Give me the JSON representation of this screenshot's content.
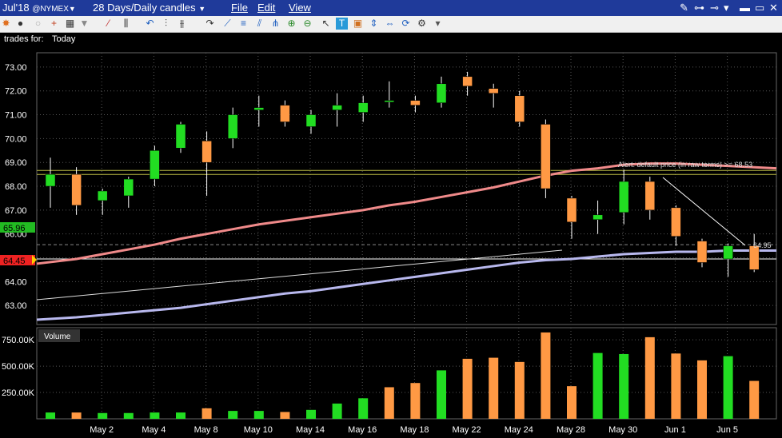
{
  "titlebar": {
    "contract": "Jul'18",
    "exchange": "@NYMEX",
    "period": "28 Days/Daily candles",
    "menu_file": "File",
    "menu_edit": "Edit",
    "menu_view": "View"
  },
  "infobar": {
    "trades_label": "trades for:",
    "trades_value": "Today"
  },
  "price_pane": {
    "alert_text": "Alert: default price (in raw terms) >= 68.53",
    "current_price_label": "65.96",
    "last_price_label": "64.45",
    "lower_line_label": "64.95"
  },
  "volume_pane": {
    "title": "Volume"
  },
  "colors": {
    "up": "#22dd22",
    "down": "#ff9944",
    "ma_fast": "#f08a8a",
    "ma_slow": "#b8b8ee",
    "titlebar": "#1f3a9a"
  },
  "chart_data": [
    {
      "type": "candlestick",
      "ylim": [
        62.2,
        73.6
      ],
      "yticks": [
        "63.00",
        "64.00",
        "65.00",
        "66.00",
        "67.00",
        "68.00",
        "69.00",
        "70.00",
        "71.00",
        "72.00",
        "73.00"
      ],
      "xticks": [
        "May 2",
        "May 4",
        "May 8",
        "May 10",
        "May 14",
        "May 16",
        "May 18",
        "May 22",
        "May 24",
        "May 28",
        "May 30",
        "Jun 1",
        "Jun 5"
      ],
      "candles": [
        {
          "o": 68.0,
          "h": 69.2,
          "l": 67.1,
          "c": 68.5
        },
        {
          "o": 68.5,
          "h": 68.8,
          "l": 66.8,
          "c": 67.2
        },
        {
          "o": 67.4,
          "h": 67.9,
          "l": 66.8,
          "c": 67.8
        },
        {
          "o": 67.6,
          "h": 68.4,
          "l": 67.1,
          "c": 68.3
        },
        {
          "o": 68.3,
          "h": 69.7,
          "l": 68.0,
          "c": 69.5
        },
        {
          "o": 69.6,
          "h": 70.7,
          "l": 69.4,
          "c": 70.6
        },
        {
          "o": 69.9,
          "h": 70.3,
          "l": 67.6,
          "c": 69.0
        },
        {
          "o": 70.0,
          "h": 71.3,
          "l": 69.6,
          "c": 71.0
        },
        {
          "o": 71.2,
          "h": 71.8,
          "l": 70.5,
          "c": 71.3
        },
        {
          "o": 71.4,
          "h": 71.6,
          "l": 70.5,
          "c": 70.7
        },
        {
          "o": 70.5,
          "h": 71.2,
          "l": 70.2,
          "c": 71.0
        },
        {
          "o": 71.2,
          "h": 71.9,
          "l": 70.5,
          "c": 71.4
        },
        {
          "o": 71.1,
          "h": 71.8,
          "l": 70.7,
          "c": 71.5
        },
        {
          "o": 71.6,
          "h": 72.4,
          "l": 71.3,
          "c": 71.6
        },
        {
          "o": 71.6,
          "h": 71.8,
          "l": 71.1,
          "c": 71.4
        },
        {
          "o": 71.5,
          "h": 72.6,
          "l": 71.3,
          "c": 72.3
        },
        {
          "o": 72.6,
          "h": 72.8,
          "l": 71.8,
          "c": 72.2
        },
        {
          "o": 72.1,
          "h": 72.3,
          "l": 71.3,
          "c": 71.9
        },
        {
          "o": 71.8,
          "h": 72.0,
          "l": 70.5,
          "c": 70.7
        },
        {
          "o": 70.6,
          "h": 70.8,
          "l": 67.5,
          "c": 67.9
        },
        {
          "o": 67.5,
          "h": 67.6,
          "l": 65.8,
          "c": 66.5
        },
        {
          "o": 66.6,
          "h": 67.4,
          "l": 66.0,
          "c": 66.8
        },
        {
          "o": 66.9,
          "h": 68.7,
          "l": 66.4,
          "c": 68.2
        },
        {
          "o": 68.2,
          "h": 68.4,
          "l": 66.6,
          "c": 67.0
        },
        {
          "o": 67.1,
          "h": 67.2,
          "l": 65.5,
          "c": 65.9
        },
        {
          "o": 65.7,
          "h": 65.8,
          "l": 64.6,
          "c": 64.8
        },
        {
          "o": 64.95,
          "h": 65.6,
          "l": 64.2,
          "c": 65.5
        },
        {
          "o": 65.5,
          "h": 66.0,
          "l": 64.4,
          "c": 64.5
        }
      ],
      "ma_fast": [
        64.75,
        64.95,
        65.15,
        65.35,
        65.55,
        65.8,
        66.0,
        66.2,
        66.4,
        66.55,
        66.7,
        66.85,
        67.0,
        67.2,
        67.35,
        67.55,
        67.75,
        67.95,
        68.2,
        68.45,
        68.65,
        68.75,
        68.9,
        68.95,
        68.95,
        68.9,
        68.85,
        68.75
      ],
      "ma_slow": [
        62.4,
        62.5,
        62.6,
        62.7,
        62.8,
        62.9,
        63.05,
        63.2,
        63.35,
        63.5,
        63.6,
        63.75,
        63.9,
        64.05,
        64.2,
        64.35,
        64.5,
        64.65,
        64.8,
        64.9,
        64.95,
        65.05,
        65.15,
        65.2,
        65.25,
        65.25,
        65.3,
        65.3
      ],
      "h_lines": [
        68.53,
        64.95
      ],
      "dashed_line": 65.55
    },
    {
      "type": "bar",
      "title": "Volume",
      "ylim": [
        0,
        850
      ],
      "yticks": [
        "250.00K",
        "500.00K",
        "750.00K"
      ],
      "values": [
        60,
        60,
        55,
        55,
        60,
        60,
        100,
        75,
        75,
        65,
        85,
        145,
        195,
        300,
        340,
        460,
        570,
        580,
        540,
        820,
        310,
        625,
        615,
        775,
        620,
        555,
        595,
        360
      ],
      "colors": [
        "up",
        "down",
        "up",
        "up",
        "up",
        "up",
        "down",
        "up",
        "up",
        "down",
        "up",
        "up",
        "up",
        "down",
        "down",
        "up",
        "down",
        "down",
        "down",
        "down",
        "down",
        "up",
        "up",
        "down",
        "down",
        "down",
        "up",
        "down"
      ]
    }
  ]
}
